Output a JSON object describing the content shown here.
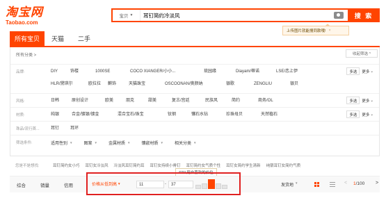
{
  "logo": {
    "cn": "淘宝网",
    "en": "Taobao.com"
  },
  "search": {
    "scope": "宝贝",
    "query": "耳钉简约冷淡风",
    "button": "搜 索"
  },
  "tip": {
    "text": "上传图片就能搜同款哦!",
    "close": "×"
  },
  "tabs": [
    "所有宝贝",
    "天猫",
    "二手"
  ],
  "filters": {
    "crumb": "所有分类 >",
    "collapse": "收起筛选 ^",
    "multi": "多选",
    "more": "更多",
    "brand_label": "品牌:",
    "brands_row1": [
      "DIY",
      "饰楼",
      "1000SE",
      "COCO XIANGER/小小...",
      "琉园缘",
      "Diayam/蒂诺",
      "LSE/恋上伊"
    ],
    "brands_row2": [
      "HLR/黛琪尔",
      "欧拉拉",
      "麒饰",
      "天猫珠宝",
      "OSCOONAN/奥颜纳",
      "银歌",
      "ZENGLIU",
      "银贝"
    ],
    "style_label": "风格:",
    "styles": [
      "日韩",
      "原创设计",
      "欧美",
      "朋克",
      "甜美",
      "复古/宫廷",
      "民族风",
      "简约",
      "商务/OL"
    ],
    "material_label": "材质:",
    "materials": [
      "纯银",
      "合金/镀银/镀金",
      "混合宝石/珠宝",
      "钛钢",
      "镶石水钻",
      "珍珠母贝",
      "天然植石"
    ],
    "category_label": "珠品/流行首...",
    "categories": [
      "耳钉",
      "耳环"
    ],
    "more_label": "筛选条件:",
    "dropdowns": [
      "适用性别",
      "图案",
      "金属材质",
      "镶嵌材质",
      "相关分类"
    ]
  },
  "related": {
    "label": "您是不是想找:",
    "items": [
      "耳钉简约女小巧",
      "耳钉女冷淡风",
      "冷淡风耳钉简约耳",
      "耳钉女持续小骨钉",
      "耳钉简约女气质个性",
      "耳钉女简约学生清新",
      "纯银耳钉女简约气质"
    ]
  },
  "sortbar": {
    "items": [
      "综合",
      "销量",
      "信用"
    ],
    "price_sort": "价格从低到高",
    "price_min": "11",
    "price_max": "37",
    "dash": "-",
    "shipping": "发货地",
    "page_current": "1",
    "page_total": "/100",
    "prev": "<",
    "next": ">"
  },
  "price_tip": "60%用户喜欢的价位",
  "price_distribution": {
    "bars_relative_height": [
      0.45,
      0.55,
      1.0,
      0.6,
      0.4
    ],
    "selected_index": 2
  },
  "colors": {
    "brand": "#ff4400",
    "highlight": "#e02020"
  }
}
